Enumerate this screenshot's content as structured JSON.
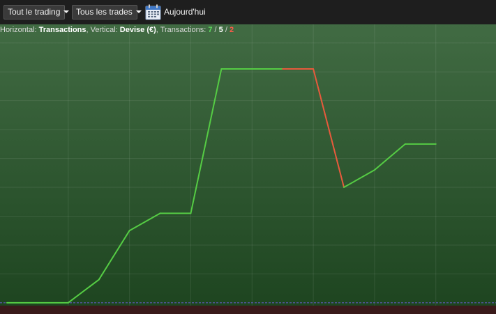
{
  "toolbar": {
    "filter_scope": "Tout le trading",
    "filter_trades": "Tous les trades",
    "date_label": "Aujourd'hui"
  },
  "info": {
    "horizontal_prefix": "Horizontal: ",
    "horizontal_value": "Transactions",
    "vertical_prefix": ", Vertical: ",
    "vertical_value": "Devise (€)",
    "transactions_prefix": ", Transactions: ",
    "total": "7",
    "slash1": " / ",
    "winners": "5",
    "slash2": " / ",
    "losers": "2"
  },
  "colors": {
    "gain_line": "#55cc44",
    "loss_line": "#e85a3c",
    "baseline": "#6a5ad0",
    "background_top": "#416b43",
    "background_bottom": "#1e4520"
  },
  "chart_data": {
    "type": "line",
    "x": [
      0,
      1,
      2,
      3,
      4,
      5,
      6,
      7,
      8,
      9,
      10,
      11,
      12,
      13,
      14
    ],
    "y": [
      0,
      0,
      0,
      0.8,
      2.5,
      3.1,
      3.1,
      8.1,
      8.1,
      8.1,
      8.1,
      4.0,
      4.6,
      5.5,
      5.5
    ],
    "point_colors": [
      "gain",
      "gain",
      "gain",
      "gain",
      "gain",
      "gain",
      "gain",
      "gain",
      "gain",
      "gain",
      "loss",
      "loss",
      "gain",
      "gain",
      "gain"
    ],
    "xlim": [
      0,
      15.6
    ],
    "ylim": [
      -0.1,
      9.5
    ],
    "grid": true,
    "legend": "none"
  }
}
